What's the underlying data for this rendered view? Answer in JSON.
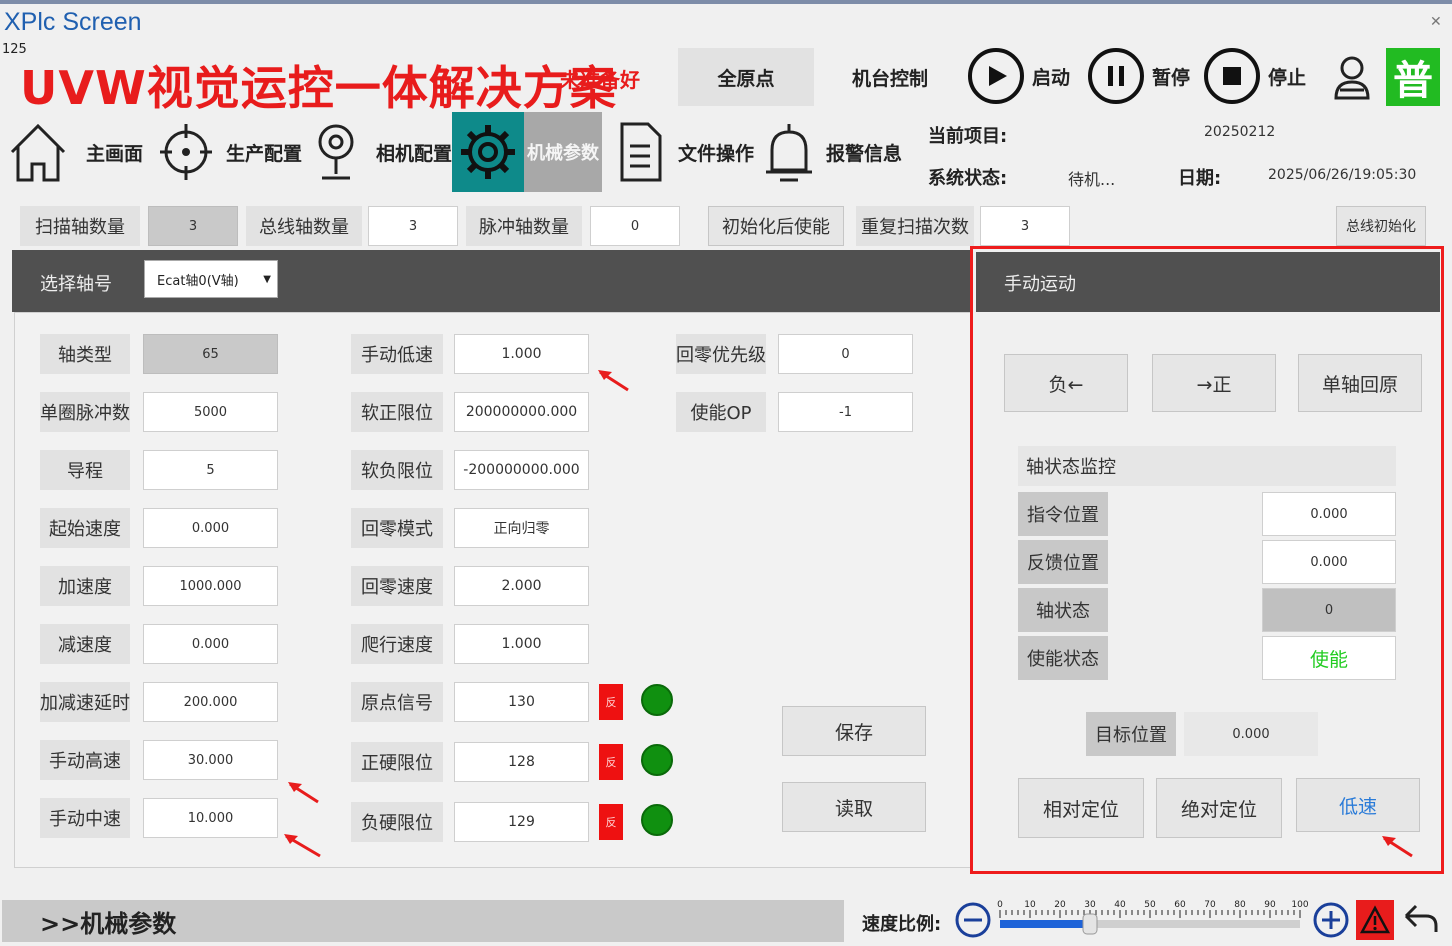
{
  "app_title": "XPlc Screen",
  "counter": "125",
  "banner": {
    "title": "UVW视觉运控一体解决方案",
    "status": "未准备好"
  },
  "header": {
    "home_origin": "全原点",
    "machine_control": "机台控制",
    "start": "启动",
    "pause": "暂停",
    "stop": "停止",
    "mode_badge": "普"
  },
  "nav": {
    "items": [
      {
        "label": "主画面",
        "icon": "home-icon"
      },
      {
        "label": "生产配置",
        "icon": "target-icon"
      },
      {
        "label": "相机配置",
        "icon": "camera-icon"
      },
      {
        "label": "机械参数",
        "icon": "gear-icon",
        "active": true
      },
      {
        "label": "文件操作",
        "icon": "document-icon"
      },
      {
        "label": "报警信息",
        "icon": "bell-icon"
      }
    ]
  },
  "info": {
    "project_label": "当前项目:",
    "project_value": "20250212",
    "status_label": "系统状态:",
    "status_value": "待机...",
    "date_label": "日期:",
    "date_value": "2025/06/26/19:05:30"
  },
  "counts": {
    "scan_axis_label": "扫描轴数量",
    "scan_axis_value": "3",
    "bus_axis_label": "总线轴数量",
    "bus_axis_value": "3",
    "pulse_axis_label": "脉冲轴数量",
    "pulse_axis_value": "0",
    "enable_after_init": "初始化后使能",
    "repeat_scan_label": "重复扫描次数",
    "repeat_scan_value": "3",
    "bus_init": "总线初始化"
  },
  "axis_select": {
    "label": "选择轴号",
    "value": "Ecat轴0(V轴)"
  },
  "params_col1": [
    {
      "label": "轴类型",
      "value": "65",
      "gray": true
    },
    {
      "label": "单圈脉冲数",
      "value": "5000"
    },
    {
      "label": "导程",
      "value": "5"
    },
    {
      "label": "起始速度",
      "value": "0.000"
    },
    {
      "label": "加速度",
      "value": "1000.000"
    },
    {
      "label": "减速度",
      "value": "0.000"
    },
    {
      "label": "加减速延时",
      "value": "200.000"
    },
    {
      "label": "手动高速",
      "value": "30.000"
    },
    {
      "label": "手动中速",
      "value": "10.000"
    }
  ],
  "params_col2": [
    {
      "label": "手动低速",
      "value": "1.000"
    },
    {
      "label": "软正限位",
      "value": "200000000.000"
    },
    {
      "label": "软负限位",
      "value": "-200000000.000"
    },
    {
      "label": "回零模式",
      "value": "正向归零"
    },
    {
      "label": "回零速度",
      "value": "2.000"
    },
    {
      "label": "爬行速度",
      "value": "1.000"
    },
    {
      "label": "原点信号",
      "value": "130",
      "flag": "反"
    },
    {
      "label": "正硬限位",
      "value": "128",
      "flag": "反"
    },
    {
      "label": "负硬限位",
      "value": "129",
      "flag": "反"
    }
  ],
  "params_col3": [
    {
      "label": "回零优先级",
      "value": "0"
    },
    {
      "label": "使能OP",
      "value": "-1"
    }
  ],
  "actions": {
    "save": "保存",
    "read": "读取"
  },
  "manual": {
    "title": "手动运动",
    "neg": "负←",
    "pos": "→正",
    "home_single": "单轴回原",
    "monitor_title": "轴状态监控",
    "rows": [
      {
        "label": "指令位置",
        "value": "0.000"
      },
      {
        "label": "反馈位置",
        "value": "0.000"
      },
      {
        "label": "轴状态",
        "value": "0"
      },
      {
        "label": "使能状态",
        "value": "使能"
      }
    ],
    "target_label": "目标位置",
    "target_value": "0.000",
    "relative": "相对定位",
    "absolute": "绝对定位",
    "speed": "低速"
  },
  "footer": {
    "breadcrumb": ">>机械参数",
    "speed_label": "速度比例:",
    "speed_ticks": [
      "0",
      "10",
      "20",
      "30",
      "40",
      "50",
      "60",
      "70",
      "80",
      "90",
      "100"
    ],
    "speed_value": 30
  },
  "colors": {
    "accent_teal": "#0e8a8a",
    "alert_red": "#e81c1c",
    "ok_green": "#109010",
    "enable_text": "#22cc22"
  }
}
